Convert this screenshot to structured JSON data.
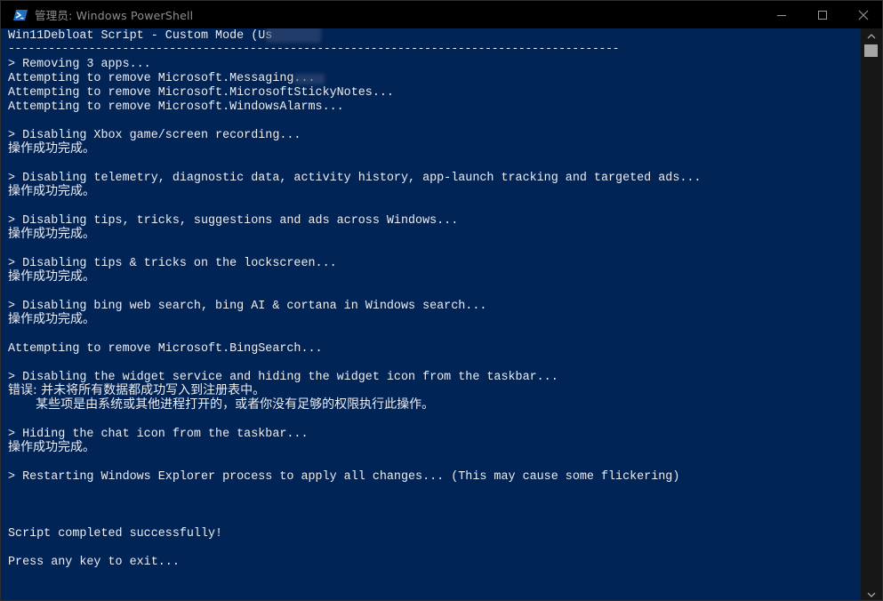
{
  "window": {
    "title": "管理员: Windows PowerShell",
    "minimize_icon": "minimize-icon",
    "maximize_icon": "maximize-icon",
    "close_icon": "close-icon"
  },
  "console": {
    "lines": [
      "Win11Debloat Script - Custom Mode (Us",
      "-------------------------------------------------------------------------------------------",
      "> Removing 3 apps...",
      "Attempting to remove Microsoft.Messaging...",
      "Attempting to remove Microsoft.MicrosoftStickyNotes...",
      "Attempting to remove Microsoft.WindowsAlarms...",
      "> Disabling Xbox game/screen recording...",
      "操作成功完成。",
      "> Disabling telemetry, diagnostic data, activity history, app-launch tracking and targeted ads...",
      "操作成功完成。",
      "> Disabling tips, tricks, suggestions and ads across Windows...",
      "操作成功完成。",
      "> Disabling tips & tricks on the lockscreen...",
      "操作成功完成。",
      "> Disabling bing web search, bing AI & cortana in Windows search...",
      "操作成功完成。",
      "Attempting to remove Microsoft.BingSearch...",
      "> Disabling the widget service and hiding the widget icon from the taskbar...",
      "错误: 并未将所有数据都成功写入到注册表中。",
      "       某些项是由系统或其他进程打开的，或者你没有足够的权限执行此操作。",
      "> Hiding the chat icon from the taskbar...",
      "操作成功完成。",
      "> Restarting Windows Explorer process to apply all changes... (This may cause some flickering)",
      "Script completed successfully!",
      "Press any key to exit..."
    ]
  },
  "colors": {
    "console_bg": "#012456",
    "console_fg": "#eeedf0",
    "titlebar_bg": "#000000",
    "scrollbar_bg": "#171717"
  }
}
